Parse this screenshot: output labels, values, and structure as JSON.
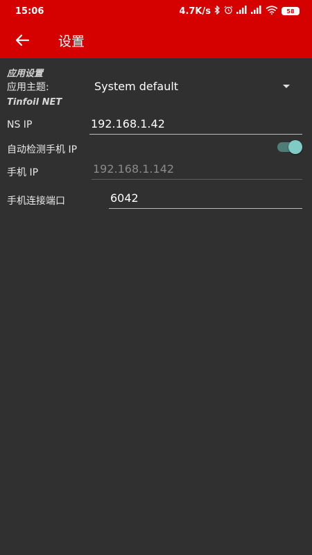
{
  "status_bar": {
    "time": "15:06",
    "net_speed": "4.7K/s",
    "battery": "58"
  },
  "app_bar": {
    "title": "设置"
  },
  "settings": {
    "app_section_title": "应用设置",
    "theme_label": "应用主题:",
    "theme_value": "System default",
    "tinfoil_section_title": "Tinfoil NET",
    "ns_ip_label": "NS IP",
    "ns_ip_value": "192.168.1.42",
    "auto_detect_label": "自动检测手机 IP",
    "auto_detect_enabled": true,
    "phone_ip_label": "手机 IP",
    "phone_ip_placeholder": "192.168.1.142",
    "phone_port_label": "手机连接端口",
    "phone_port_value": "6042"
  },
  "colors": {
    "primary": "#d50000",
    "background": "#303030",
    "switch_thumb": "#80cbc4"
  }
}
